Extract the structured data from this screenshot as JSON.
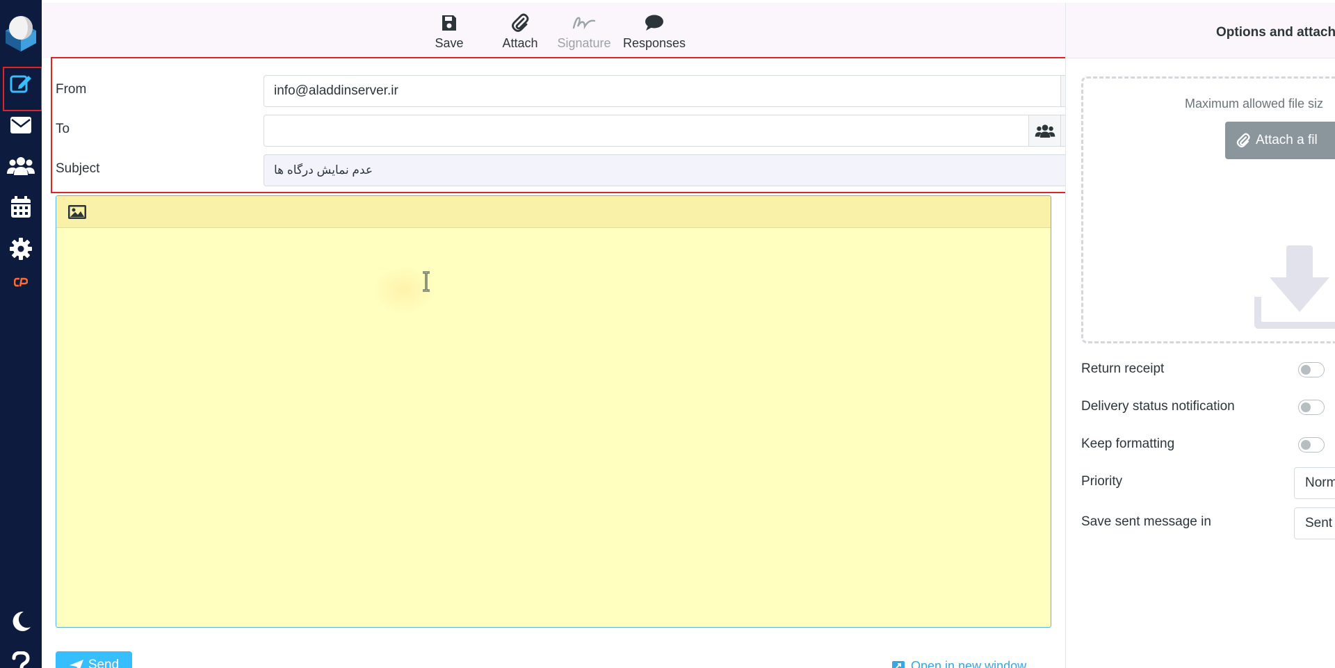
{
  "toolbar": {
    "save": "Save",
    "attach": "Attach",
    "signature": "Signature",
    "responses": "Responses"
  },
  "headers": {
    "from_label": "From",
    "from_value": "info@aladdinserver.ir",
    "to_label": "To",
    "to_value": "",
    "subject_label": "Subject",
    "subject_value": "عدم نمایش درگاه ها"
  },
  "editor": {
    "body": ""
  },
  "footer": {
    "send_label": "Send",
    "open_new_window": "Open in new window"
  },
  "options_panel": {
    "title": "Options and attachm",
    "max_size_text": "Maximum allowed file siz",
    "attach_file_label": "Attach a fil",
    "return_receipt": "Return receipt",
    "delivery_status": "Delivery status notification",
    "keep_formatting": "Keep formatting",
    "priority_label": "Priority",
    "priority_value": "Norm",
    "save_sent_label": "Save sent message in",
    "save_sent_value": "Sent"
  },
  "colors": {
    "sidebar_bg": "#0c1b3e",
    "accent": "#37beff",
    "editor_bg": "#ffffbf",
    "highlight_box": "#e02424"
  },
  "icons": [
    "compose-icon",
    "mail-icon",
    "contacts-icon",
    "calendar-icon",
    "settings-icon",
    "cpanel-icon",
    "dark-mode-icon",
    "help-icon",
    "save-icon",
    "paperclip-icon",
    "signature-icon",
    "comment-icon",
    "pencil-icon",
    "users-icon",
    "plus-icon",
    "image-icon",
    "download-icon"
  ]
}
